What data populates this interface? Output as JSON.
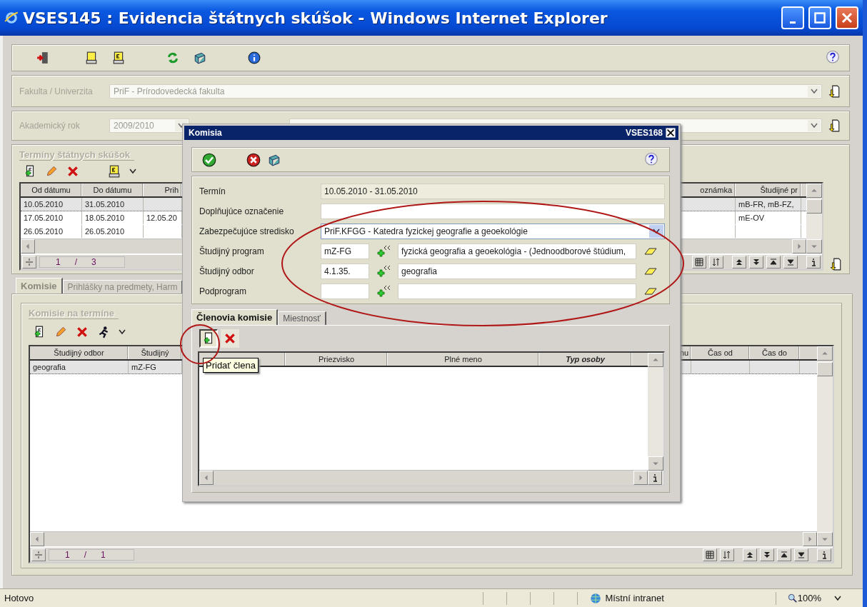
{
  "window": {
    "title": "VSES145 : Evidencia štátnych skúšok - Windows Internet Explorer"
  },
  "filters": [
    {
      "label": "Fakulta / Univerzita",
      "value": "PriF - Prírodovedecká fakulta",
      "kind": "wide",
      "disabled": true
    },
    {
      "label": "Akademický rok",
      "value": "2009/2010",
      "kind": "split",
      "disabled": true
    }
  ],
  "terminy": {
    "title": "Termíny štátnych skúšok",
    "columns": [
      "Od dátumu",
      "Do dátumu",
      "Prih",
      "oznámka",
      "Študijné pr"
    ],
    "rows": [
      {
        "cells": [
          "10.05.2010",
          "31.05.2010",
          "",
          "",
          "mB-FR, mB-FZ,"
        ],
        "selected": true
      },
      {
        "cells": [
          "17.05.2010",
          "18.05.2010",
          "12.05.20",
          "",
          "mE-OV"
        ],
        "selected": false
      },
      {
        "cells": [
          "26.05.2010",
          "26.05.2010",
          "",
          "",
          ""
        ],
        "selected": false
      }
    ],
    "pager": {
      "page": "1",
      "separator": "/",
      "total": "3"
    }
  },
  "tabs": [
    {
      "label": "Komisie",
      "selected": true
    },
    {
      "label": "Prihlášky na predmety, Harm",
      "selected": false
    }
  ],
  "komisie": {
    "title": "Komisie na termíne",
    "columns": [
      "Študijný odbor",
      "Študijný",
      "nu",
      "Čas od",
      "Čas do"
    ],
    "rows": [
      {
        "cells": [
          "geografia",
          "mZ-FG",
          "",
          "",
          ""
        ],
        "selected": true
      }
    ],
    "pager": {
      "page": "1",
      "separator": "/",
      "total": "1"
    }
  },
  "dialog": {
    "title": "Komisia",
    "code": "VSES168",
    "fields": [
      {
        "label": "Termín",
        "kind": "readonly",
        "value": "10.05.2010 - 31.05.2010"
      },
      {
        "label": "Doplňujúce označenie",
        "kind": "text"
      },
      {
        "label": "Zabezpečujúce stredisko",
        "kind": "select",
        "value": "PriF.KFGG - Katedra fyzickej geografie a geoekológie"
      },
      {
        "label": "Študijný program",
        "kind": "lookup",
        "code": "mZ-FG",
        "name": "fyzická geografia a geoekológia - (Jednoodborové štúdium,"
      },
      {
        "label": "Študijný odbor",
        "kind": "lookup",
        "code": "4.1.35.",
        "name": "geografia"
      },
      {
        "label": "Podprogram",
        "kind": "lookup"
      }
    ],
    "tabs": [
      {
        "label": "Členovia komisie",
        "selected": true
      },
      {
        "label": "Miestnosť",
        "selected": false
      }
    ],
    "members_table": {
      "columns": [
        {
          "label": "Priezvisko",
          "emphasis": false
        },
        {
          "label": "Plné meno",
          "emphasis": false
        },
        {
          "label": "Typ osoby",
          "emphasis": true
        }
      ]
    },
    "tooltip": "Pridať člena"
  },
  "status_bar": {
    "text": "Hotovo",
    "zone": "Místní intranet",
    "zoom": "100%"
  }
}
